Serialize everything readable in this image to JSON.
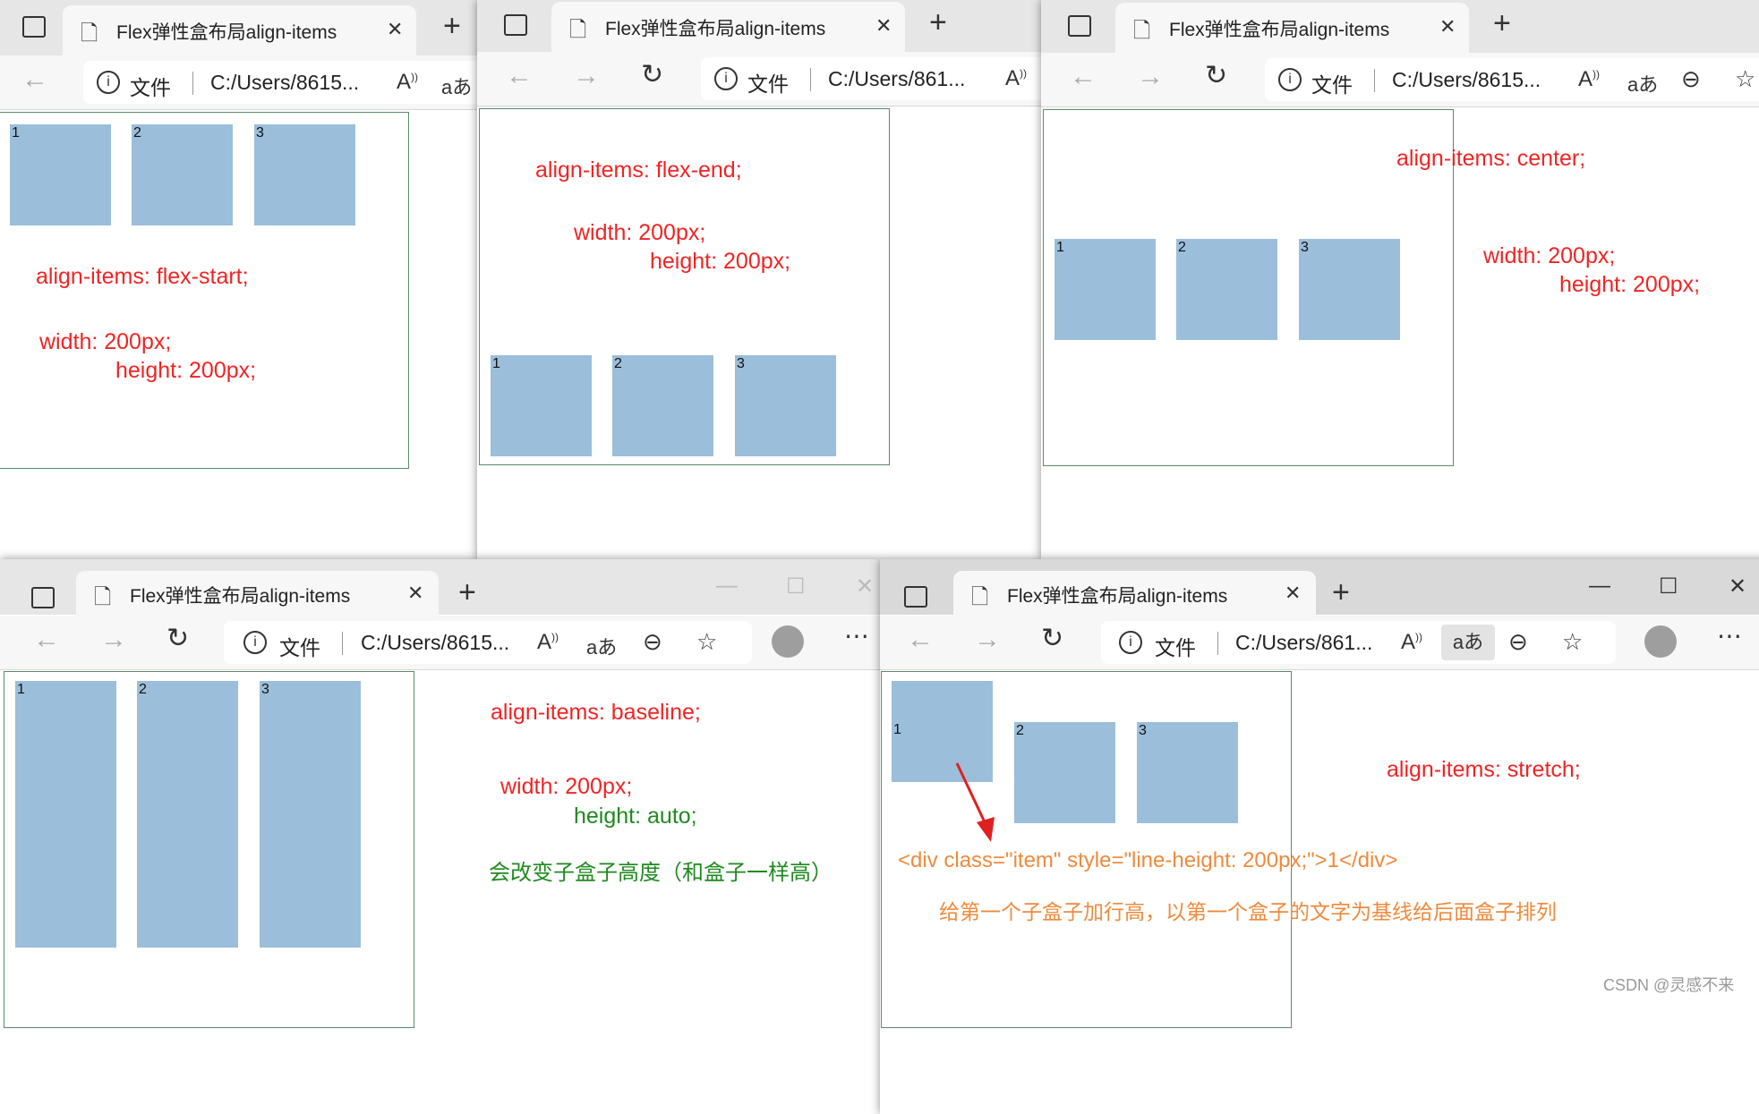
{
  "tab_title": "Flex弹性盒布局align-items",
  "address": {
    "file_label": "文件",
    "path_short": "C:/Users/8615...",
    "path_shorter": "C:/Users/861..."
  },
  "window_controls": {
    "minimize": "—",
    "maximize": "☐",
    "close": "✕"
  },
  "box_labels": [
    "1",
    "2",
    "3"
  ],
  "panels": {
    "flex_start": {
      "align": "align-items: flex-start;",
      "width": "width: 200px;",
      "height": "height: 200px;"
    },
    "flex_end": {
      "align": "align-items: flex-end;",
      "width": "width: 200px;",
      "height": "height: 200px;"
    },
    "center": {
      "align": "align-items: center;",
      "width": "width: 200px;",
      "height": "height: 200px;"
    },
    "baseline": {
      "align": "align-items: baseline;",
      "width": "width: 200px;",
      "height": "height: auto;",
      "note": "会改变子盒子高度（和盒子一样高）"
    },
    "stretch": {
      "align": "align-items: stretch;",
      "code": "<div class=\"item\" style=\"line-height: 200px;\">1</div>",
      "note": "给第一个子盒子加行高，以第一个盒子的文字为基线给后面盒子排列"
    }
  },
  "watermark": "CSDN @灵感不来",
  "colors": {
    "box": "#9bbedb",
    "red": "#f02424",
    "green": "#1f8a1f",
    "orange": "#ef8a3c",
    "border": "#5a8a6a"
  }
}
